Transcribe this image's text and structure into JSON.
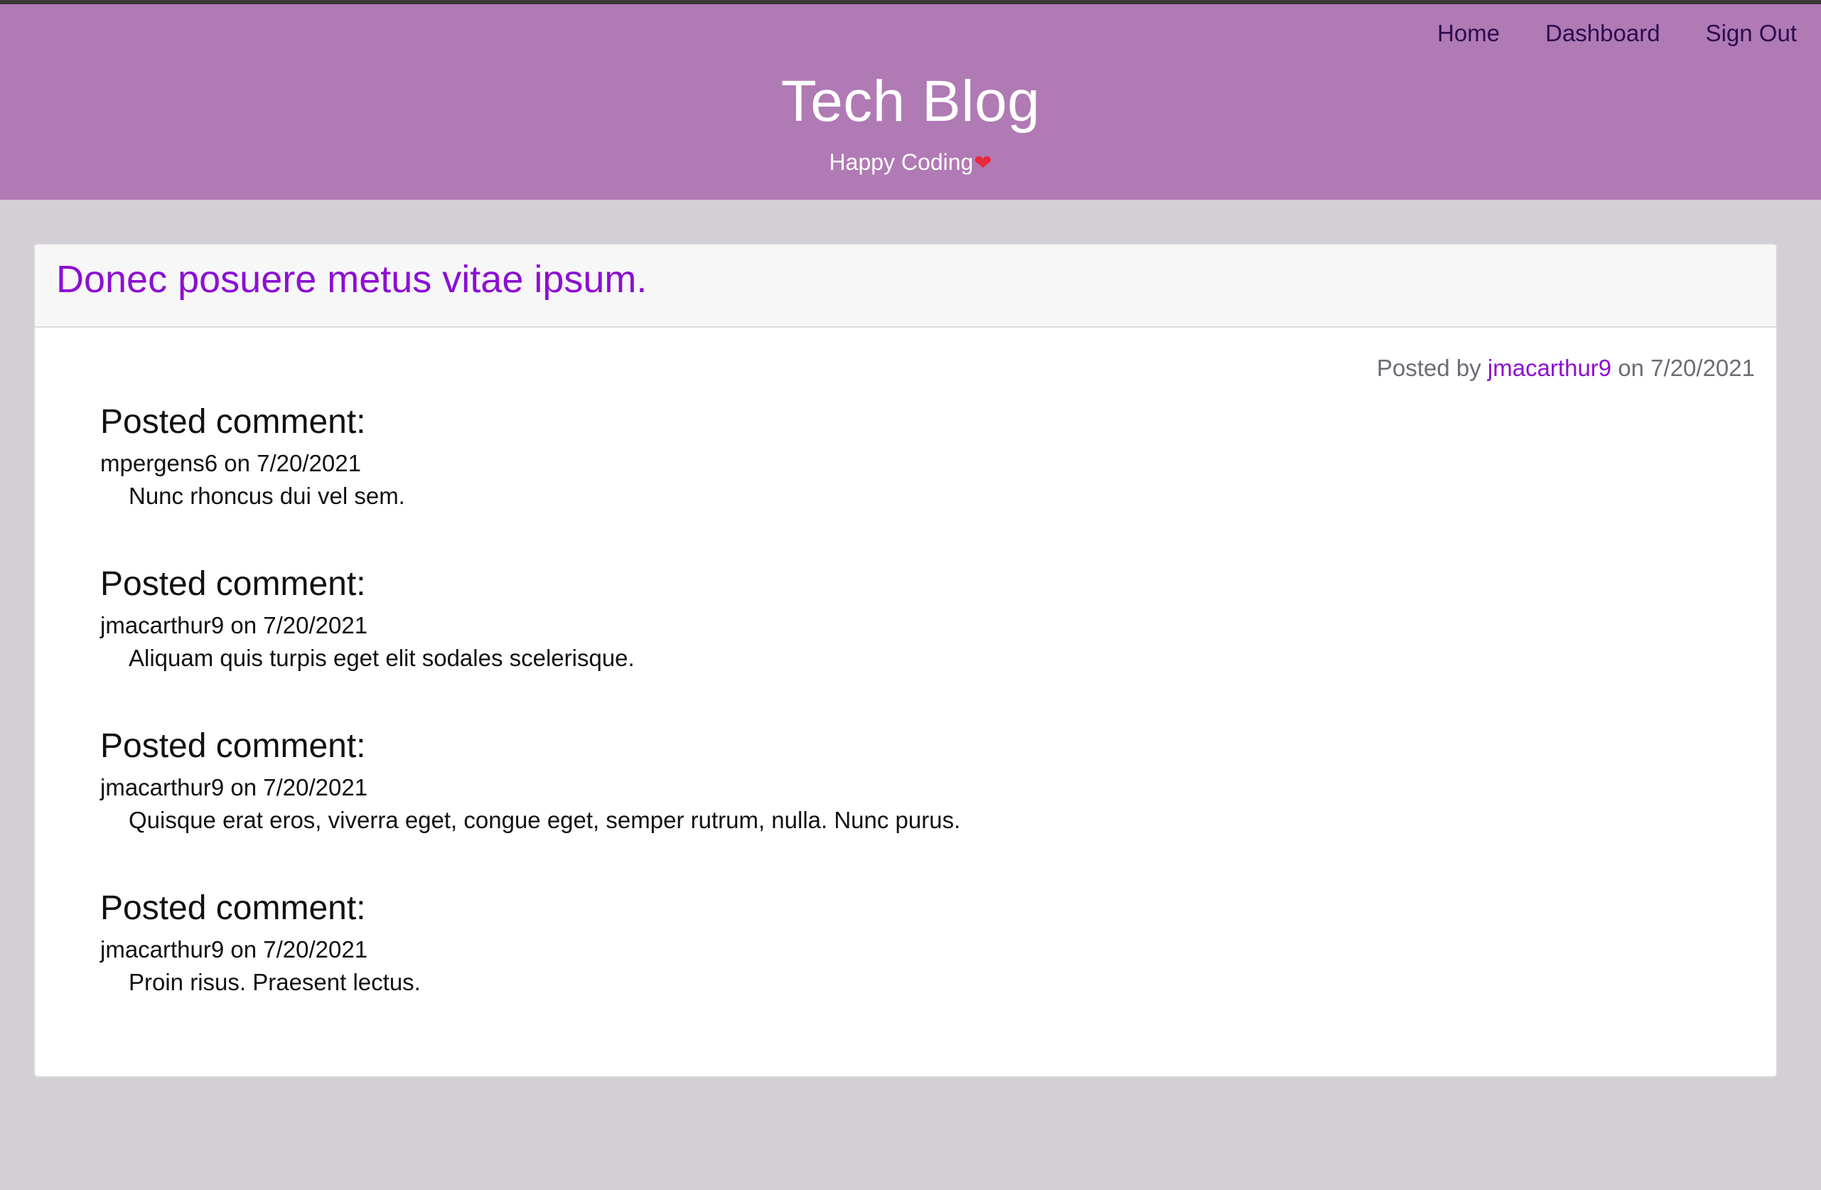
{
  "nav": {
    "home": "Home",
    "dashboard": "Dashboard",
    "signout": "Sign Out"
  },
  "header": {
    "title": "Tech Blog",
    "tagline": "Happy Coding",
    "tagline_icon": "heart-icon"
  },
  "post": {
    "title": "Donec posuere metus vitae ipsum.",
    "meta_prefix": "Posted by",
    "author": "jmacarthur9",
    "meta_suffix": "on 7/20/2021"
  },
  "comments": [
    {
      "heading": "Posted comment:",
      "meta": "mpergens6 on 7/20/2021",
      "text": "Nunc rhoncus dui vel sem."
    },
    {
      "heading": "Posted comment:",
      "meta": "jmacarthur9 on 7/20/2021",
      "text": "Aliquam quis turpis eget elit sodales scelerisque."
    },
    {
      "heading": "Posted comment:",
      "meta": "jmacarthur9 on 7/20/2021",
      "text": "Quisque erat eros, viverra eget, congue eget, semper rutrum, nulla. Nunc purus."
    },
    {
      "heading": "Posted comment:",
      "meta": "jmacarthur9 on 7/20/2021",
      "text": "Proin risus. Praesent lectus."
    }
  ],
  "colors": {
    "header_bg": "#b07ab4",
    "page_bg": "#d3cfd5",
    "accent": "#8c0fd3",
    "nav_text": "#2c0b4d"
  }
}
